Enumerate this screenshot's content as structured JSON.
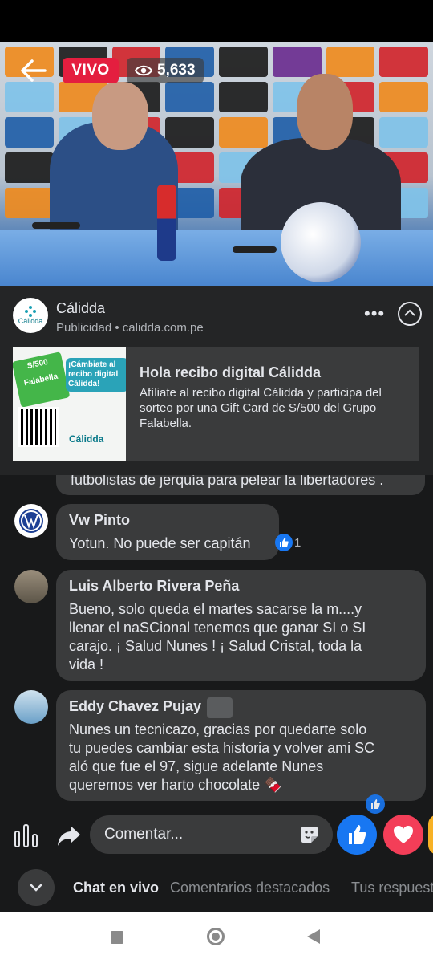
{
  "video": {
    "live_label": "VIVO",
    "viewer_count": "5,633"
  },
  "ad": {
    "advertiser": "Cálidda",
    "logo_text": "Cálidda",
    "sponsored": "Publicidad • calidda.com.pe",
    "title": "Hola recibo digital Cálidda",
    "description": "Afíliate al recibo digital Cálidda y participa del sorteo por una Gift Card de S/500 del Grupo Falabella.",
    "image": {
      "headline": "¡Cámbiate al recibo digital Cálidda!",
      "card_amount": "S/500",
      "card_brand": "Falabella",
      "brand": "Cálidda"
    }
  },
  "comments": {
    "cutoff_text": "futbolistas de jerquía para pelear la libertadores .",
    "items": [
      {
        "name": "Vw Pinto",
        "text": "Yotun. No puede ser capitán",
        "reactions": "1"
      },
      {
        "name": "Luis Alberto Rivera Peña",
        "text": "Bueno, solo queda el martes sacarse la m....y\nllenar el naSCional  tenemos que ganar SI o SI\ncarajo. ¡ Salud Nunes ! ¡ Salud Cristal, toda la\nvida !"
      },
      {
        "name": "Eddy Chavez Pujay",
        "text": "Nunes un tecnicazo,  gracias por quedarte  solo\ntu puedes cambiar esta historia y volver ami SC\naló que fue el 97,     sigue adelante Nunes\nqueremos ver harto chocolate 🍫"
      }
    ]
  },
  "composer": {
    "placeholder": "Comentar..."
  },
  "tabs": {
    "live_chat": "Chat en vivo",
    "top_comments": "Comentarios destacados",
    "your_replies": "Tus respuest"
  }
}
